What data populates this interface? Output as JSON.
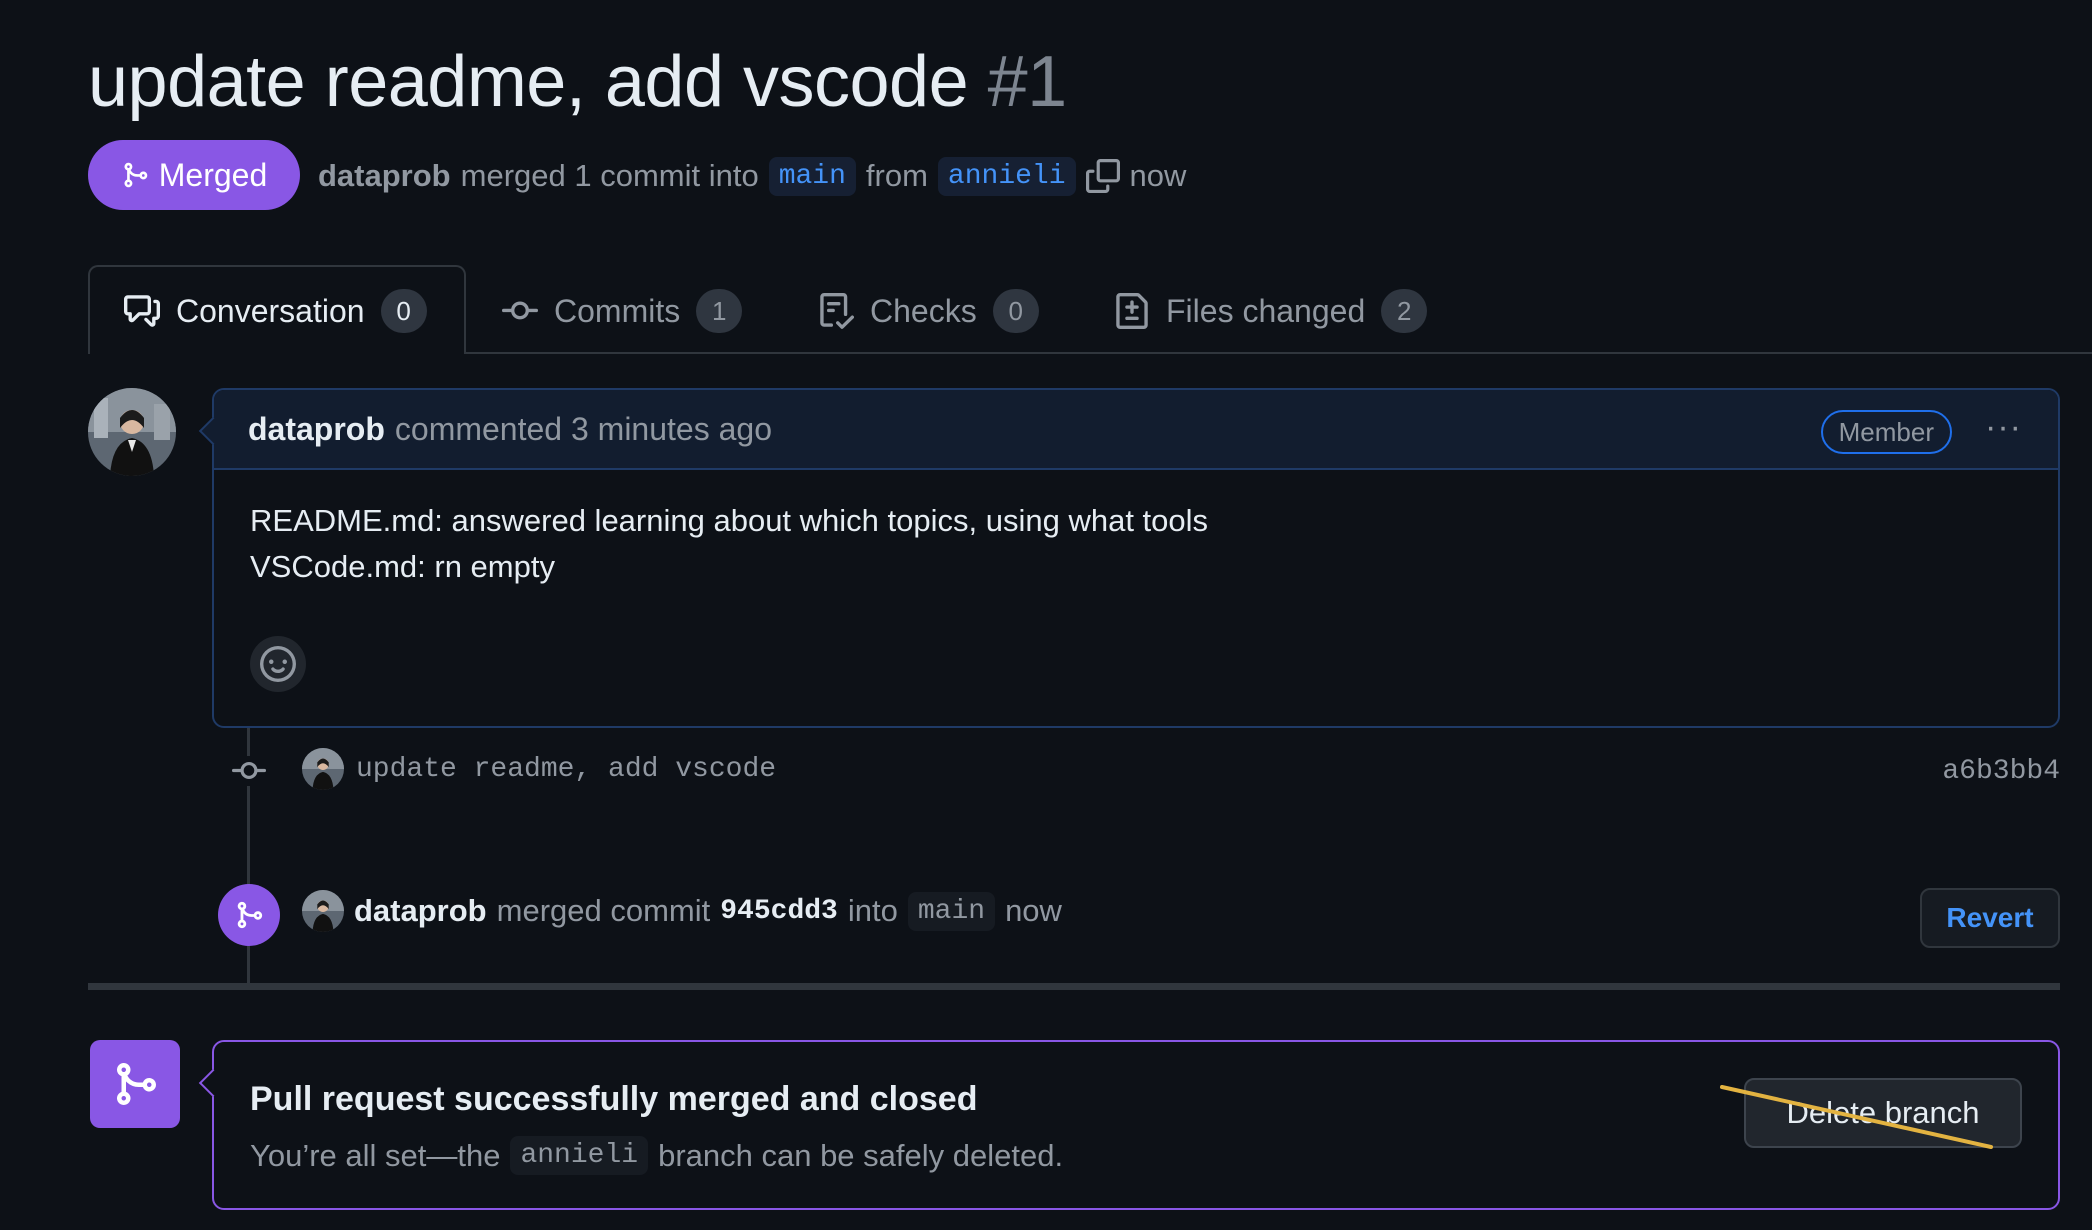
{
  "pr": {
    "title": "update readme, add vscode",
    "number": "#1",
    "state": "Merged",
    "author": "dataprob",
    "merged_text": "merged 1 commit into",
    "base_branch": "main",
    "from_text": "from",
    "head_branch": "annieli",
    "time": "now"
  },
  "tabs": [
    {
      "label": "Conversation",
      "count": "0",
      "icon": "comment-discussion-icon"
    },
    {
      "label": "Commits",
      "count": "1",
      "icon": "git-commit-icon"
    },
    {
      "label": "Checks",
      "count": "0",
      "icon": "checklist-icon"
    },
    {
      "label": "Files changed",
      "count": "2",
      "icon": "file-diff-icon"
    }
  ],
  "comment": {
    "author": "dataprob",
    "meta": "commented 3 minutes ago",
    "badge": "Member",
    "more": "···",
    "lines": [
      "README.md: answered learning about which topics, using what tools",
      "VSCode.md: rn empty"
    ]
  },
  "commit": {
    "message": "update readme, add vscode",
    "sha": "a6b3bb4"
  },
  "merge_event": {
    "author": "dataprob",
    "text1": "merged commit",
    "sha": "945cdd3",
    "text2": "into",
    "branch": "main",
    "time": "now",
    "revert_label": "Revert"
  },
  "merge_status": {
    "title": "Pull request successfully merged and closed",
    "desc_before": "You’re all set—the",
    "branch": "annieli",
    "desc_after": "branch can be safely deleted.",
    "delete_label": "Delete branch"
  },
  "colors": {
    "background": "#0d1117",
    "merged_purple": "#8957e5",
    "link_blue": "#4493f8",
    "annotation_yellow": "#e3b341"
  }
}
